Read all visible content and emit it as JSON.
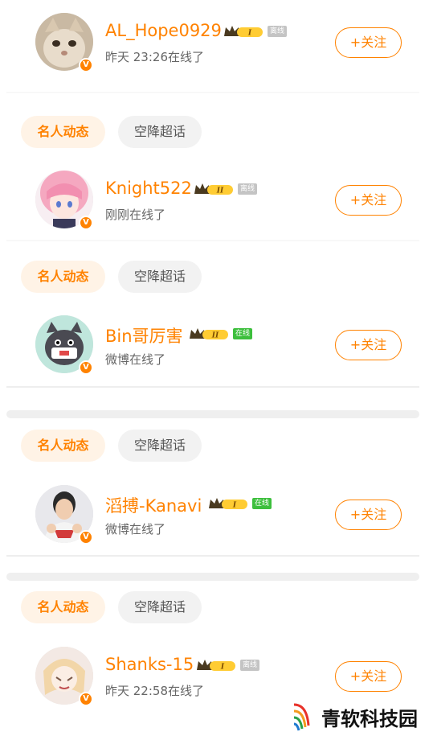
{
  "users": [
    {
      "name": "AL_Hope0929",
      "level": "I",
      "status": "离线",
      "online": false,
      "sub": "昨天 23:26在线了",
      "follow": "+关注",
      "avatar": "cat-avatar"
    },
    {
      "name": "Knight522",
      "level": "II",
      "status": "离线",
      "online": false,
      "sub": "刚刚在线了",
      "follow": "+关注",
      "avatar": "anime-girl-avatar"
    },
    {
      "name": "Bin哥厉害",
      "level": "II",
      "status": "在线",
      "online": true,
      "sub": "微博在线了",
      "follow": "+关注",
      "avatar": "cartoon-mascot-avatar"
    },
    {
      "name": "滔搏-Kanavi",
      "level": "I",
      "status": "在线",
      "online": true,
      "sub": "微博在线了",
      "follow": "+关注",
      "avatar": "player-photo-avatar"
    },
    {
      "name": "Shanks-15",
      "level": "I",
      "status": "离线",
      "online": false,
      "sub": "昨天 22:58在线了",
      "follow": "+关注",
      "avatar": "drawing-avatar"
    }
  ],
  "chips": [
    {
      "primary": "名人动态",
      "secondary": "空降超话"
    },
    {
      "primary": "名人动态",
      "secondary": "空降超话"
    },
    {
      "primary": "名人动态",
      "secondary": "空降超话"
    },
    {
      "primary": "名人动态",
      "secondary": "空降超话"
    }
  ],
  "verified_badge": "V",
  "watermark": {
    "text": "青软科技园"
  },
  "colors": {
    "accent": "#ff8200",
    "chip_bg": "#fff3e6",
    "online": "#3dbf3d",
    "offline": "#c4c4c4"
  }
}
